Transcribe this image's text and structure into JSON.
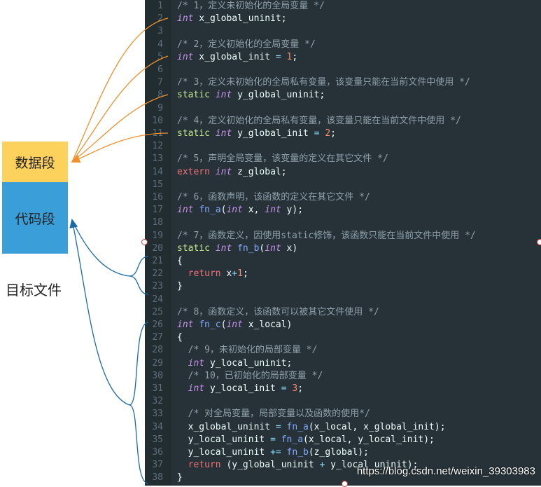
{
  "labels": {
    "data_segment": "数据段",
    "code_segment": "代码段",
    "target_file": "目标文件"
  },
  "colors": {
    "data_box": "#fcd15c",
    "code_box": "#3a9fd8",
    "data_arrows": "#f0902a",
    "code_arrows": "#1a6aa8",
    "editor_bg": "#263238"
  },
  "code_lines": [
    [
      [
        "cm",
        "/* 1，定义未初始化的全局变量 */"
      ]
    ],
    [
      [
        "ty",
        "int"
      ],
      [
        "id",
        " x_global_uninit;"
      ]
    ],
    [],
    [
      [
        "cm",
        "/* 2，定义初始化的全局变量 */"
      ]
    ],
    [
      [
        "ty",
        "int"
      ],
      [
        "id",
        " x_global_init "
      ],
      [
        "op",
        "="
      ],
      [
        "id",
        " "
      ],
      [
        "nm",
        "1"
      ],
      [
        "id",
        ";"
      ]
    ],
    [],
    [
      [
        "cm",
        "/* 3，定义未初始化的全局私有变量，该变量只能在当前文件中使用 */"
      ]
    ],
    [
      [
        "kw",
        "static"
      ],
      [
        "id",
        " "
      ],
      [
        "ty",
        "int"
      ],
      [
        "id",
        " y_global_uninit;"
      ]
    ],
    [],
    [
      [
        "cm",
        "/* 4，定义初始化的全局私有变量，该变量只能在当前文件中使用 */"
      ]
    ],
    [
      [
        "kw",
        "static"
      ],
      [
        "id",
        " "
      ],
      [
        "ty",
        "int"
      ],
      [
        "id",
        " y_global_init "
      ],
      [
        "op",
        "="
      ],
      [
        "id",
        " "
      ],
      [
        "nm",
        "2"
      ],
      [
        "id",
        ";"
      ]
    ],
    [],
    [
      [
        "cm",
        "/* 5，声明全局变量，该变量的定义在其它文件 */"
      ]
    ],
    [
      [
        "kw2",
        "extern"
      ],
      [
        "id",
        " "
      ],
      [
        "ty",
        "int"
      ],
      [
        "id",
        " z_global;"
      ]
    ],
    [],
    [
      [
        "cm",
        "/* 6，函数声明，该函数的定义在其它文件 */"
      ]
    ],
    [
      [
        "ty",
        "int"
      ],
      [
        "id",
        " "
      ],
      [
        "fn",
        "fn_a"
      ],
      [
        "id",
        "("
      ],
      [
        "ty",
        "int"
      ],
      [
        "id",
        " x, "
      ],
      [
        "ty",
        "int"
      ],
      [
        "id",
        " y);"
      ]
    ],
    [],
    [
      [
        "cm",
        "/* 7，函数定义，因使用static修饰，该函数只能在当前文件中使用 */"
      ]
    ],
    [
      [
        "kw",
        "static"
      ],
      [
        "id",
        " "
      ],
      [
        "ty",
        "int"
      ],
      [
        "id",
        " "
      ],
      [
        "fn",
        "fn_b"
      ],
      [
        "id",
        "("
      ],
      [
        "ty",
        "int"
      ],
      [
        "id",
        " x)"
      ]
    ],
    [
      [
        "id",
        "{"
      ]
    ],
    [
      [
        "id",
        "  "
      ],
      [
        "kw2",
        "return"
      ],
      [
        "id",
        " x"
      ],
      [
        "op",
        "+"
      ],
      [
        "nm",
        "1"
      ],
      [
        "id",
        ";"
      ]
    ],
    [
      [
        "id",
        "}"
      ]
    ],
    [],
    [
      [
        "cm",
        "/* 8，函数定义，该函数可以被其它文件使用 */"
      ]
    ],
    [
      [
        "ty",
        "int"
      ],
      [
        "id",
        " "
      ],
      [
        "fn",
        "fn_c"
      ],
      [
        "id",
        "("
      ],
      [
        "ty",
        "int"
      ],
      [
        "id",
        " x_local)"
      ]
    ],
    [
      [
        "id",
        "{"
      ]
    ],
    [
      [
        "id",
        "  "
      ],
      [
        "cm",
        "/* 9，未初始化的局部变量 */"
      ]
    ],
    [
      [
        "id",
        "  "
      ],
      [
        "ty",
        "int"
      ],
      [
        "id",
        " y_local_uninit;"
      ]
    ],
    [
      [
        "id",
        "  "
      ],
      [
        "cm",
        "/* 10，已初始化的局部变量 */"
      ]
    ],
    [
      [
        "id",
        "  "
      ],
      [
        "ty",
        "int"
      ],
      [
        "id",
        " y_local_init "
      ],
      [
        "op",
        "="
      ],
      [
        "id",
        " "
      ],
      [
        "nm",
        "3"
      ],
      [
        "id",
        ";"
      ]
    ],
    [],
    [
      [
        "id",
        "  "
      ],
      [
        "cm",
        "/* 对全局变量，局部变量以及函数的使用*/"
      ]
    ],
    [
      [
        "id",
        "  x_global_uninit "
      ],
      [
        "op",
        "="
      ],
      [
        "id",
        " "
      ],
      [
        "fn",
        "fn_a"
      ],
      [
        "id",
        "(x_local, x_global_init);"
      ]
    ],
    [
      [
        "id",
        "  y_local_uninit "
      ],
      [
        "op",
        "="
      ],
      [
        "id",
        " "
      ],
      [
        "fn",
        "fn_a"
      ],
      [
        "id",
        "(x_local, y_local_init);"
      ]
    ],
    [
      [
        "id",
        "  y_local_uninit "
      ],
      [
        "op",
        "+="
      ],
      [
        "id",
        " "
      ],
      [
        "fn",
        "fn_b"
      ],
      [
        "id",
        "(z_global);"
      ]
    ],
    [
      [
        "id",
        "  "
      ],
      [
        "kw2",
        "return"
      ],
      [
        "id",
        " (y_global_uninit "
      ],
      [
        "op",
        "+"
      ],
      [
        "id",
        " y_local_uninit);"
      ]
    ],
    [
      [
        "id",
        "}"
      ]
    ]
  ],
  "watermark": "https://blog.csdn.net/weixin_39303983"
}
